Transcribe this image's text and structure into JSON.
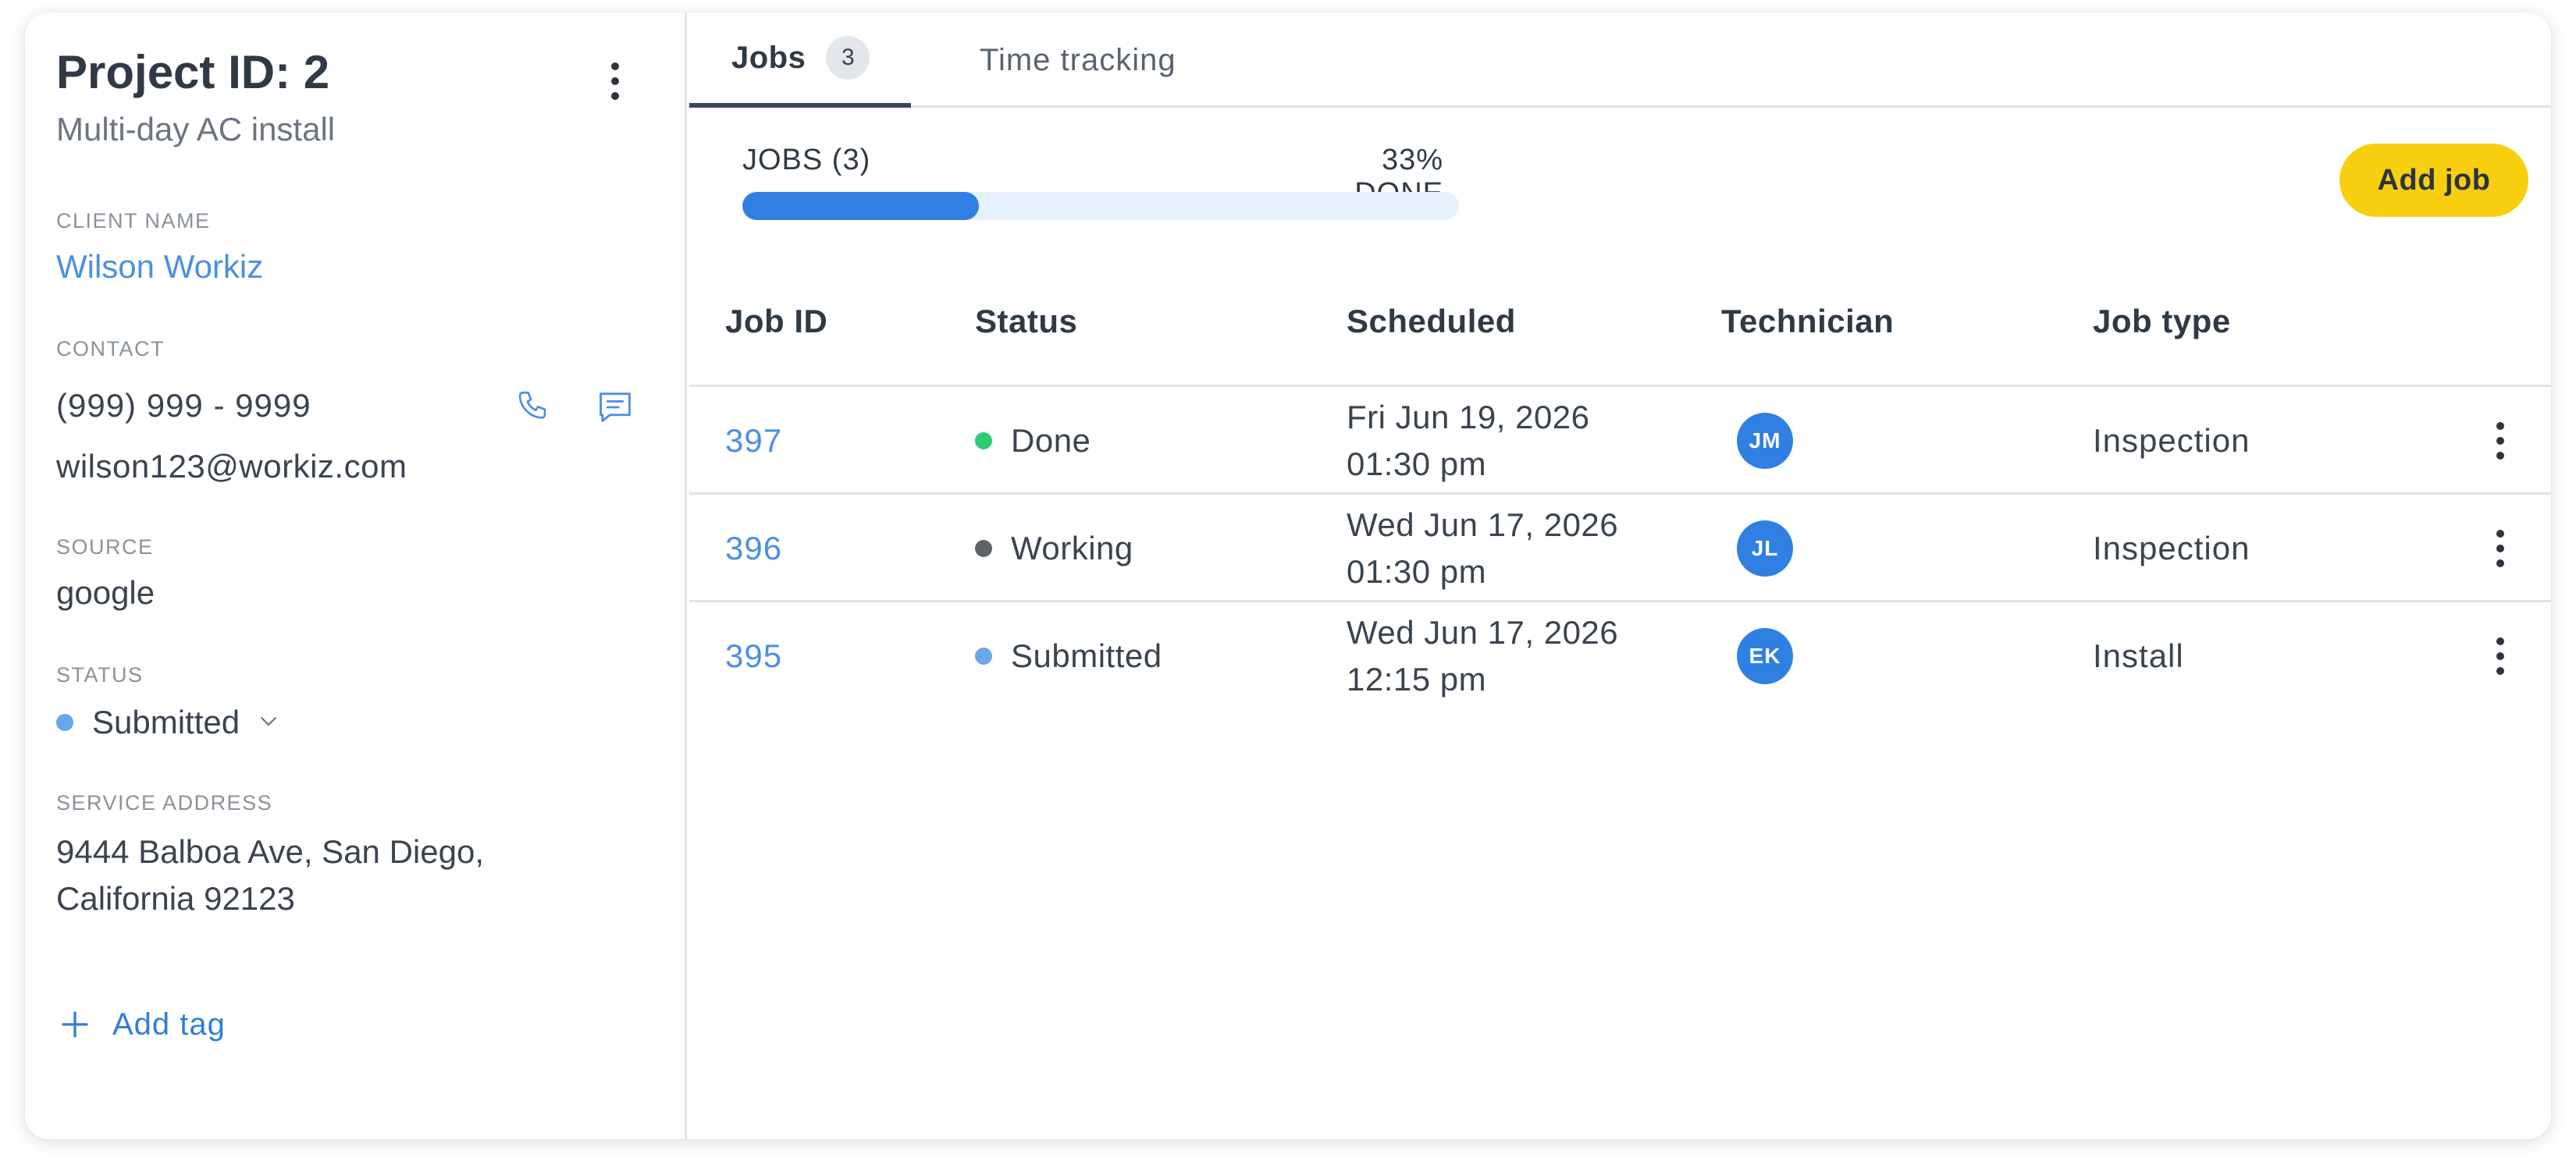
{
  "project": {
    "title": "Project ID: 2",
    "subtitle": "Multi-day AC install",
    "client_label": "CLIENT NAME",
    "client_name": "Wilson Workiz",
    "contact_label": "CONTACT",
    "phone": "(999) 999 - 9999",
    "email": "wilson123@workiz.com",
    "source_label": "SOURCE",
    "source": "google",
    "status_label": "STATUS",
    "status": "Submitted",
    "status_color": "#6aa6e8",
    "address_label": "SERVICE ADDRESS",
    "address": "9444 Balboa Ave, San Diego, California 92123",
    "add_tag_label": "Add tag"
  },
  "tabs": [
    {
      "label": "Jobs",
      "badge": "3",
      "active": true
    },
    {
      "label": "Time tracking",
      "active": false
    }
  ],
  "progress": {
    "label": "JOBS (3)",
    "percent_label": "33% DONE",
    "fraction": 0.33,
    "color": "#2f80e2"
  },
  "add_job_label": "Add job",
  "table": {
    "headers": {
      "job_id": "Job ID",
      "status": "Status",
      "scheduled": "Scheduled",
      "technician": "Technician",
      "job_type": "Job type"
    },
    "rows": [
      {
        "job_id": "397",
        "status": "Done",
        "status_color": "#2ecc71",
        "date": "Fri Jun 19, 2026",
        "time": "01:30 pm",
        "tech": "JM",
        "job_type": "Inspection"
      },
      {
        "job_id": "396",
        "status": "Working",
        "status_color": "#5f6266",
        "date": "Wed Jun 17, 2026",
        "time": "01:30 pm",
        "tech": "JL",
        "job_type": "Inspection"
      },
      {
        "job_id": "395",
        "status": "Submitted",
        "status_color": "#6aa6e8",
        "date": "Wed Jun 17, 2026",
        "time": "12:15 pm",
        "tech": "EK",
        "job_type": "Install"
      }
    ]
  },
  "icons": {
    "project_menu": "kebab-icon",
    "phone": "phone-icon",
    "message": "message-icon",
    "status_dropdown": "chevron-down-icon",
    "add_tag": "plus-icon",
    "row_menu": "kebab-icon"
  }
}
